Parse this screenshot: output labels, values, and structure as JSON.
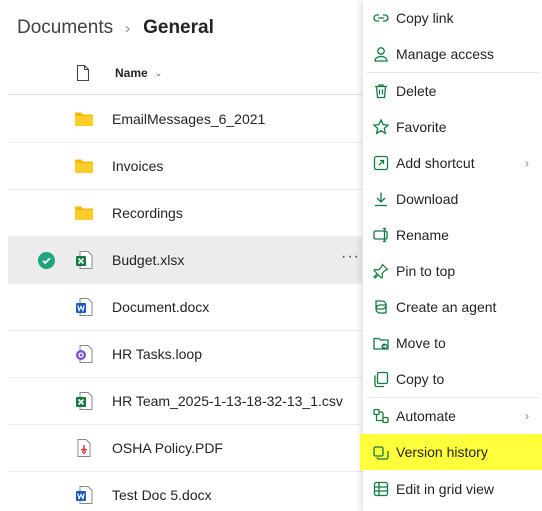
{
  "breadcrumb": {
    "root": "Documents",
    "separator": "›",
    "current": "General"
  },
  "list_header": {
    "name_label": "Name",
    "sort_icon": "chevron-down-icon"
  },
  "files": [
    {
      "name": "EmailMessages_6_2021",
      "type": "folder"
    },
    {
      "name": "Invoices",
      "type": "folder"
    },
    {
      "name": "Recordings",
      "type": "folder"
    },
    {
      "name": "Budget.xlsx",
      "type": "excel",
      "selected": true,
      "more": "···"
    },
    {
      "name": "Document.docx",
      "type": "word"
    },
    {
      "name": "HR Tasks.loop",
      "type": "loop"
    },
    {
      "name": "HR Team_2025-1-13-18-32-13_1.csv",
      "type": "csv"
    },
    {
      "name": "OSHA Policy.PDF",
      "type": "pdf"
    },
    {
      "name": "Test Doc 5.docx",
      "type": "word"
    }
  ],
  "context_menu": {
    "items": [
      {
        "label": "Copy link",
        "icon": "link-icon"
      },
      {
        "label": "Manage access",
        "icon": "person-icon"
      },
      {
        "label": "Delete",
        "icon": "trash-icon"
      },
      {
        "label": "Favorite",
        "icon": "star-icon"
      },
      {
        "label": "Add shortcut",
        "icon": "shortcut-icon",
        "submenu": true
      },
      {
        "label": "Download",
        "icon": "download-icon"
      },
      {
        "label": "Rename",
        "icon": "rename-icon"
      },
      {
        "label": "Pin to top",
        "icon": "pin-icon"
      },
      {
        "label": "Create an agent",
        "icon": "copilot-icon"
      },
      {
        "label": "Move to",
        "icon": "folder-move-icon"
      },
      {
        "label": "Copy to",
        "icon": "copy-icon"
      },
      {
        "label": "Automate",
        "icon": "flow-icon",
        "submenu": true
      },
      {
        "label": "Version history",
        "icon": "version-history-icon",
        "highlighted": true
      },
      {
        "label": "Edit in grid view",
        "icon": "grid-icon"
      }
    ],
    "submenu_glyph": "›"
  },
  "colors": {
    "menu_icon": "#107c41",
    "highlight": "#ffff3b",
    "selected_row": "#ececec",
    "check": "#1fa37f",
    "folder": "#f5c518"
  }
}
